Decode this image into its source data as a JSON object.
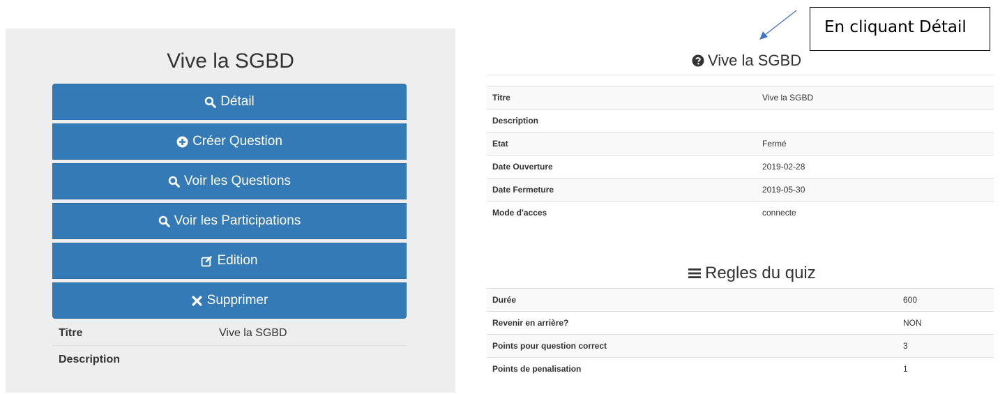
{
  "left": {
    "title": "Vive la SGBD",
    "buttons": [
      {
        "label": "Détail",
        "icon": "search-icon"
      },
      {
        "label": "Créer Question",
        "icon": "plus-circle-icon"
      },
      {
        "label": "Voir les Questions",
        "icon": "search-icon"
      },
      {
        "label": "Voir les Participations",
        "icon": "search-icon"
      },
      {
        "label": "Edition",
        "icon": "edit-icon"
      },
      {
        "label": "Supprimer",
        "icon": "times-icon"
      }
    ],
    "info": [
      {
        "label": "Titre",
        "value": "Vive la SGBD"
      },
      {
        "label": "Description",
        "value": ""
      }
    ]
  },
  "callout": {
    "text": "En cliquant Détail"
  },
  "detail": {
    "title": "Vive la SGBD",
    "rows": [
      {
        "label": "Titre",
        "value": "Vive la SGBD"
      },
      {
        "label": "Description",
        "value": ""
      },
      {
        "label": "Etat",
        "value": "Fermé"
      },
      {
        "label": "Date Ouverture",
        "value": "2019-02-28"
      },
      {
        "label": "Date Fermeture",
        "value": "2019-05-30"
      },
      {
        "label": "Mode d'acces",
        "value": "connecte"
      }
    ]
  },
  "rules": {
    "title": "Regles du quiz",
    "rows": [
      {
        "label": "Durée",
        "value": "600"
      },
      {
        "label": "Revenir en arrière?",
        "value": "NON"
      },
      {
        "label": "Points pour question correct",
        "value": "3"
      },
      {
        "label": "Points de penalisation",
        "value": "1"
      }
    ]
  },
  "colors": {
    "button": "#337ab7",
    "panel": "#eeeeee"
  }
}
